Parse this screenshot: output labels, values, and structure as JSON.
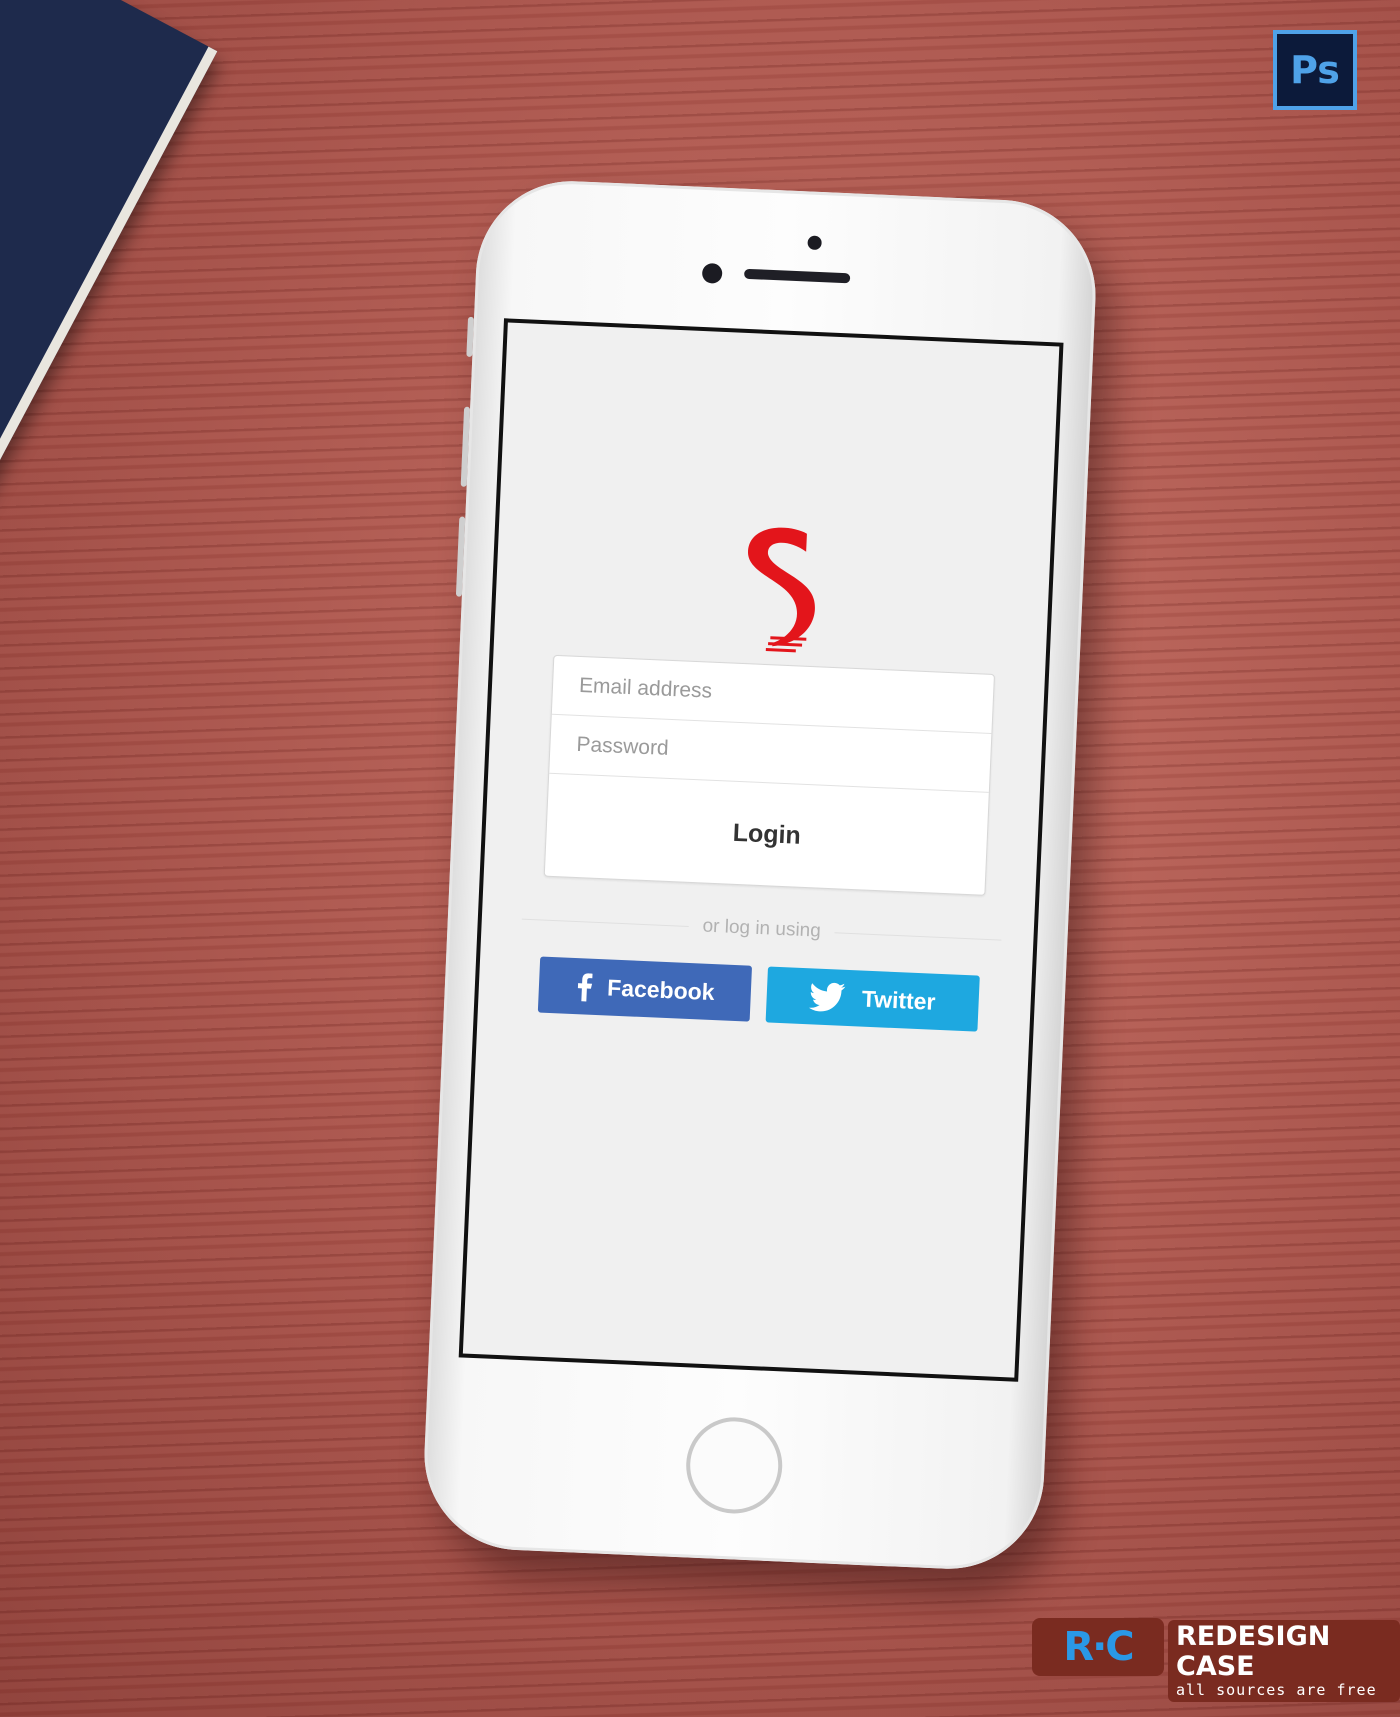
{
  "app": {
    "logo_letter": "S",
    "brand_color": "#e3151b"
  },
  "login_form": {
    "email_placeholder": "Email address",
    "password_placeholder": "Password",
    "login_label": "Login"
  },
  "divider": {
    "text": "or log in using"
  },
  "social": {
    "facebook": {
      "label": "Facebook",
      "icon": "facebook-icon",
      "color": "#3f69b8"
    },
    "twitter": {
      "label": "Twitter",
      "icon": "twitter-bird-icon",
      "color": "#1ea8e0"
    }
  },
  "badges": {
    "photoshop": "Ps"
  },
  "watermark": {
    "logo": "R·C",
    "title": "REDESIGN CASE",
    "subtitle": "all sources are free"
  }
}
